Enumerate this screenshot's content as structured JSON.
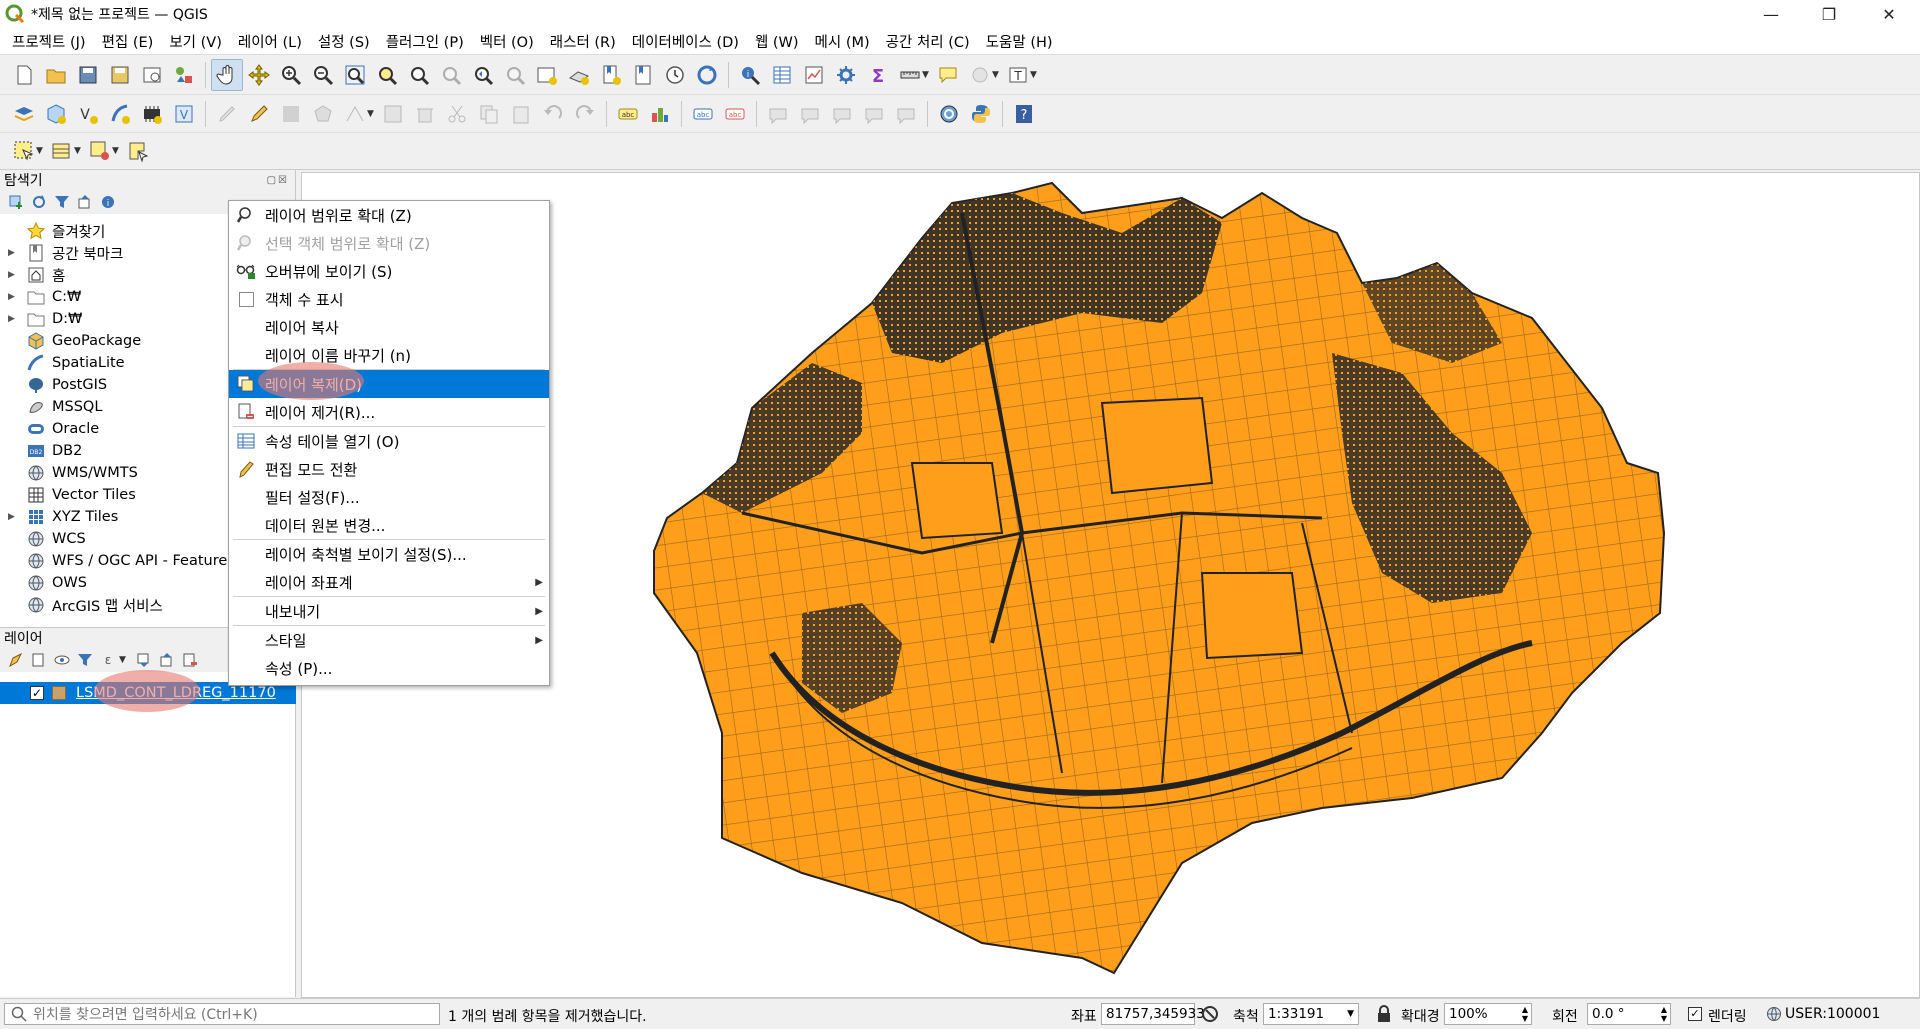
{
  "window": {
    "title": "*제목 없는 프로젝트 — QGIS",
    "minimize_glyph": "—",
    "maximize_glyph": "❐",
    "close_glyph": "✕"
  },
  "menu": [
    "프로젝트 (J)",
    "편집 (E)",
    "보기 (V)",
    "레이어 (L)",
    "설정 (S)",
    "플러그인 (P)",
    "벡터 (O)",
    "래스터 (R)",
    "데이터베이스 (D)",
    "웹 (W)",
    "메시 (M)",
    "공간 처리 (C)",
    "도움말 (H)"
  ],
  "browser": {
    "title": "탐색기",
    "items": [
      {
        "label": "즐겨찾기",
        "icon": "star-icon",
        "arrow": ""
      },
      {
        "label": "공간 북마크",
        "icon": "bookmark-icon",
        "arrow": "▶"
      },
      {
        "label": "홈",
        "icon": "home-icon",
        "arrow": "▶"
      },
      {
        "label": "C:₩",
        "icon": "folder-icon",
        "arrow": "▶"
      },
      {
        "label": "D:₩",
        "icon": "folder-icon",
        "arrow": "▶"
      },
      {
        "label": "GeoPackage",
        "icon": "geopackage-icon",
        "arrow": ""
      },
      {
        "label": "SpatiaLite",
        "icon": "spatialite-icon",
        "arrow": ""
      },
      {
        "label": "PostGIS",
        "icon": "postgis-icon",
        "arrow": ""
      },
      {
        "label": "MSSQL",
        "icon": "mssql-icon",
        "arrow": ""
      },
      {
        "label": "Oracle",
        "icon": "oracle-icon",
        "arrow": ""
      },
      {
        "label": "DB2",
        "icon": "db2-icon",
        "arrow": ""
      },
      {
        "label": "WMS/WMTS",
        "icon": "globe-icon",
        "arrow": ""
      },
      {
        "label": "Vector Tiles",
        "icon": "grid-icon",
        "arrow": ""
      },
      {
        "label": "XYZ Tiles",
        "icon": "tiles-icon",
        "arrow": "▶"
      },
      {
        "label": "WCS",
        "icon": "globe-icon",
        "arrow": ""
      },
      {
        "label": "WFS / OGC API - Feature",
        "icon": "globe-icon",
        "arrow": ""
      },
      {
        "label": "OWS",
        "icon": "globe-icon",
        "arrow": ""
      },
      {
        "label": "ArcGIS 맵 서비스",
        "icon": "globe-icon",
        "arrow": ""
      }
    ]
  },
  "layers": {
    "title": "레이어",
    "layer_name": "LSMD_CONT_LDREG_11170",
    "check_glyph": "✓"
  },
  "context_menu": [
    {
      "label": "레이어 범위로 확대 (Z)",
      "icon": "zoom-layer-icon",
      "state": "normal",
      "sub": false
    },
    {
      "label": "선택 객체 범위로 확대 (Z)",
      "icon": "zoom-selection-icon",
      "state": "disabled",
      "sub": false
    },
    {
      "label": "오버뷰에 보이기 (S)",
      "icon": "overview-icon",
      "state": "normal",
      "sub": false
    },
    {
      "label": "객체 수 표시",
      "icon": "checkbox-icon",
      "state": "normal",
      "sub": false
    },
    {
      "label": "레이어 복사",
      "icon": "",
      "state": "normal",
      "sub": false
    },
    {
      "label": "레이어 이름 바꾸기 (n)",
      "icon": "",
      "state": "normal",
      "sub": false,
      "sep_after": true
    },
    {
      "label": "레이어 복제(D)",
      "icon": "duplicate-layer-icon",
      "state": "selected",
      "sub": false
    },
    {
      "label": "레이어 제거(R)...",
      "icon": "remove-layer-icon",
      "state": "normal",
      "sub": false,
      "sep_after": true
    },
    {
      "label": "속성 테이블 열기 (O)",
      "icon": "attribute-table-icon",
      "state": "normal",
      "sub": false
    },
    {
      "label": "편집 모드 전환",
      "icon": "pencil-icon",
      "state": "normal",
      "sub": false
    },
    {
      "label": "필터 설정(F)...",
      "icon": "",
      "state": "normal",
      "sub": false
    },
    {
      "label": "데이터 원본 변경...",
      "icon": "",
      "state": "normal",
      "sub": false,
      "sep_after": true
    },
    {
      "label": "레이어 축척별 보이기 설정(S)...",
      "icon": "",
      "state": "normal",
      "sub": false
    },
    {
      "label": "레이어 좌표계",
      "icon": "",
      "state": "normal",
      "sub": true,
      "sep_after": true
    },
    {
      "label": "내보내기",
      "icon": "",
      "state": "normal",
      "sub": true,
      "sep_after": true
    },
    {
      "label": "스타일",
      "icon": "",
      "state": "normal",
      "sub": true
    },
    {
      "label": "속성 (P)...",
      "icon": "",
      "state": "normal",
      "sub": false
    }
  ],
  "submenu_glyph": "▶",
  "status": {
    "search_placeholder": "위치를 찾으려면 입력하세요 (Ctrl+K)",
    "message": "1 개의 범례 항목을 제거했습니다.",
    "coord_label": "좌표",
    "coord_value": "81757,345933",
    "scale_label": "축척",
    "scale_value": "1:33191",
    "magnifier_label": "확대경",
    "magnifier_value": "100%",
    "rotation_label": "회전",
    "rotation_value": "0.0 °",
    "render_label": "렌더링",
    "crs_value": "USER:100001",
    "check_glyph": "✓"
  },
  "colors": {
    "fill": "#ff9e1b",
    "stroke": "#222222",
    "selection": "#0078d7"
  }
}
